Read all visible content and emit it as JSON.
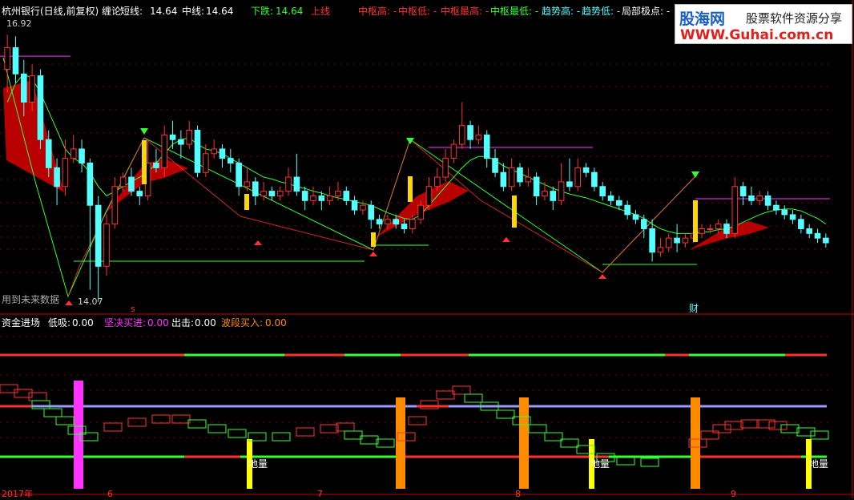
{
  "header": {
    "title": "杭州银行(日线,前复权) 缠论",
    "short_label": "短线:",
    "short_value": "14.64",
    "mid_label": "中线:",
    "mid_value": "14.64",
    "down_label": "下跌:",
    "down_value": "14.64",
    "up_label": "上线",
    "pivot_high": "中枢高: -",
    "pivot_low": "中枢低: -",
    "pivot_highest": "中枢最高: -",
    "pivot_lowest": "中枢最低: -",
    "trend_high": "趋势高: -",
    "trend_low": "趋势低: -",
    "local_extreme": "局部极点: -"
  },
  "main": {
    "high_label": "16.92",
    "low_label": "14.07",
    "future_note": "用到未来数据",
    "marker_s": "s",
    "marker_cai": "财"
  },
  "sub": {
    "title": "资金进场",
    "low_absorb_label": "低吸:",
    "low_absorb_value": "0.00",
    "firm_buy_label": "坚决买进:",
    "firm_buy_value": "0.00",
    "exit_label": "出击:",
    "exit_value": "0.00",
    "wave_buy_label": "波段买入:",
    "wave_buy_value": "0.00",
    "bottom_label": "地量"
  },
  "x_axis": {
    "labels": [
      "2017年",
      "6",
      "7",
      "8",
      "9"
    ]
  },
  "watermark": {
    "line1": "股海网",
    "line2": "股票软件资源分享",
    "line3": "WWW.Guhai.com.cn"
  },
  "colors": {
    "up": "#ff3232",
    "down": "#54ffff",
    "grid": "#8b0000",
    "green": "#33ff33",
    "purple": "#ff33ff",
    "orange": "#ff8c00",
    "yellow": "#ffff00"
  },
  "chart_data": {
    "type": "candlestick",
    "y_range": [
      14.0,
      17.1
    ],
    "price_marks": {
      "high": 16.92,
      "low": 14.07
    },
    "candles": [
      [
        16.55,
        16.78,
        16.92,
        16.3
      ],
      [
        16.78,
        16.5,
        16.9,
        16.4
      ],
      [
        16.5,
        16.2,
        16.65,
        16.05
      ],
      [
        16.2,
        16.48,
        16.6,
        16.1
      ],
      [
        16.48,
        15.8,
        16.55,
        15.7
      ],
      [
        15.8,
        15.5,
        15.9,
        15.4
      ],
      [
        15.5,
        15.3,
        15.6,
        15.1
      ],
      [
        15.3,
        15.6,
        15.8,
        15.2
      ],
      [
        15.6,
        15.7,
        15.85,
        15.55
      ],
      [
        15.7,
        15.55,
        15.8,
        15.45
      ],
      [
        15.55,
        15.1,
        15.6,
        14.2
      ],
      [
        15.1,
        14.45,
        15.2,
        14.07
      ],
      [
        14.45,
        14.9,
        15.0,
        14.35
      ],
      [
        14.9,
        15.3,
        15.4,
        14.85
      ],
      [
        15.3,
        15.4,
        15.45,
        15.25
      ],
      [
        15.4,
        15.25,
        15.5,
        15.2
      ],
      [
        15.25,
        15.2,
        15.3,
        15.1
      ],
      [
        15.2,
        15.55,
        15.8,
        15.15
      ],
      [
        15.55,
        15.5,
        15.7,
        15.45
      ],
      [
        15.5,
        15.85,
        15.95,
        15.4
      ],
      [
        15.85,
        15.8,
        16.0,
        15.7
      ],
      [
        15.8,
        15.75,
        15.9,
        15.6
      ],
      [
        15.75,
        15.9,
        16.0,
        15.7
      ],
      [
        15.9,
        15.45,
        15.95,
        15.4
      ],
      [
        15.45,
        15.65,
        15.75,
        15.4
      ],
      [
        15.65,
        15.7,
        15.8,
        15.6
      ],
      [
        15.7,
        15.6,
        15.75,
        15.5
      ],
      [
        15.6,
        15.55,
        15.7,
        15.45
      ],
      [
        15.55,
        15.3,
        15.6,
        15.2
      ],
      [
        15.3,
        15.35,
        15.5,
        15.25
      ],
      [
        15.35,
        15.2,
        15.4,
        15.1
      ],
      [
        15.2,
        15.25,
        15.35,
        15.15
      ],
      [
        15.25,
        15.2,
        15.3,
        15.15
      ],
      [
        15.2,
        15.25,
        15.3,
        15.15
      ],
      [
        15.25,
        15.4,
        15.5,
        15.2
      ],
      [
        15.4,
        15.25,
        15.65,
        15.2
      ],
      [
        15.25,
        15.15,
        15.3,
        15.05
      ],
      [
        15.15,
        15.2,
        15.3,
        15.1
      ],
      [
        15.2,
        15.15,
        15.25,
        15.05
      ],
      [
        15.15,
        15.2,
        15.3,
        15.1
      ],
      [
        15.2,
        15.25,
        15.35,
        15.15
      ],
      [
        15.25,
        15.15,
        15.3,
        15.1
      ],
      [
        15.15,
        15.05,
        15.2,
        15.0
      ],
      [
        15.05,
        15.1,
        15.15,
        15.0
      ],
      [
        15.1,
        14.95,
        15.15,
        14.85
      ],
      [
        14.95,
        14.9,
        15.0,
        14.85
      ],
      [
        14.9,
        14.95,
        15.0,
        14.85
      ],
      [
        14.95,
        14.9,
        15.0,
        14.85
      ],
      [
        14.9,
        14.85,
        14.95,
        14.8
      ],
      [
        14.85,
        14.95,
        15.0,
        14.8
      ],
      [
        14.95,
        15.1,
        15.15,
        14.9
      ],
      [
        15.1,
        15.3,
        15.4,
        15.05
      ],
      [
        15.3,
        15.4,
        15.5,
        15.25
      ],
      [
        15.4,
        15.6,
        15.7,
        15.35
      ],
      [
        15.6,
        15.75,
        15.8,
        15.55
      ],
      [
        15.75,
        15.95,
        16.2,
        15.7
      ],
      [
        15.95,
        15.8,
        16.0,
        15.7
      ],
      [
        15.8,
        15.85,
        15.95,
        15.75
      ],
      [
        15.85,
        15.6,
        15.9,
        15.5
      ],
      [
        15.6,
        15.45,
        15.7,
        15.4
      ],
      [
        15.45,
        15.3,
        15.55,
        15.25
      ],
      [
        15.3,
        15.5,
        15.6,
        15.25
      ],
      [
        15.5,
        15.35,
        15.55,
        15.3
      ],
      [
        15.35,
        15.4,
        15.5,
        15.3
      ],
      [
        15.4,
        15.2,
        15.45,
        15.1
      ],
      [
        15.2,
        15.25,
        15.35,
        15.15
      ],
      [
        15.25,
        15.15,
        15.3,
        15.05
      ],
      [
        15.15,
        15.35,
        15.55,
        15.1
      ],
      [
        15.35,
        15.3,
        15.6,
        15.25
      ],
      [
        15.3,
        15.5,
        15.6,
        15.25
      ],
      [
        15.5,
        15.45,
        15.55,
        15.4
      ],
      [
        15.45,
        15.3,
        15.5,
        15.25
      ],
      [
        15.3,
        15.2,
        15.35,
        15.15
      ],
      [
        15.2,
        15.15,
        15.25,
        15.1
      ],
      [
        15.15,
        15.1,
        15.2,
        15.05
      ],
      [
        15.1,
        15.0,
        15.15,
        14.95
      ],
      [
        15.0,
        14.95,
        15.05,
        14.9
      ],
      [
        14.95,
        14.85,
        15.0,
        14.75
      ],
      [
        14.85,
        14.6,
        14.95,
        14.5
      ],
      [
        14.6,
        14.65,
        14.75,
        14.55
      ],
      [
        14.65,
        14.75,
        14.8,
        14.6
      ],
      [
        14.75,
        14.7,
        14.9,
        14.6
      ],
      [
        14.7,
        14.75,
        14.8,
        14.65
      ],
      [
        14.75,
        14.8,
        14.85,
        14.7
      ],
      [
        14.8,
        14.85,
        14.9,
        14.75
      ],
      [
        14.85,
        14.85,
        14.9,
        14.8
      ],
      [
        14.85,
        14.9,
        14.95,
        14.8
      ],
      [
        14.9,
        14.8,
        14.95,
        14.75
      ],
      [
        14.8,
        15.3,
        15.4,
        14.75
      ],
      [
        15.3,
        15.2,
        15.35,
        15.1
      ],
      [
        15.2,
        15.15,
        15.3,
        15.1
      ],
      [
        15.15,
        15.2,
        15.25,
        15.1
      ],
      [
        15.2,
        15.1,
        15.25,
        15.05
      ],
      [
        15.1,
        15.05,
        15.15,
        15.0
      ],
      [
        15.05,
        15.0,
        15.1,
        14.95
      ],
      [
        15.0,
        14.95,
        15.05,
        14.9
      ],
      [
        14.95,
        14.85,
        15.0,
        14.8
      ],
      [
        14.85,
        14.8,
        14.9,
        14.75
      ],
      [
        14.8,
        14.75,
        14.85,
        14.7
      ],
      [
        14.75,
        14.7,
        14.8,
        14.65
      ]
    ],
    "lines": {
      "short": [
        16.2,
        16.4,
        16.5,
        16.45,
        16.3,
        16.1,
        15.9,
        15.7,
        15.6,
        15.55,
        15.45,
        15.3,
        15.2,
        15.25,
        15.3,
        15.35,
        15.4,
        15.45,
        15.55,
        15.65,
        15.75,
        15.8,
        15.82,
        15.75,
        15.7,
        15.68,
        15.65,
        15.6,
        15.55,
        15.5,
        15.45,
        15.4,
        15.38,
        15.35,
        15.33,
        15.3,
        15.28,
        15.25,
        15.23,
        15.2,
        15.18,
        15.16,
        15.14,
        15.12,
        15.1,
        15.06,
        15.02,
        14.99,
        14.96,
        14.95,
        15.0,
        15.1,
        15.2,
        15.3,
        15.4,
        15.5,
        15.58,
        15.62,
        15.62,
        15.58,
        15.52,
        15.48,
        15.44,
        15.4,
        15.36,
        15.32,
        15.28,
        15.25,
        15.22,
        15.2,
        15.18,
        15.15,
        15.12,
        15.09,
        15.06,
        15.03,
        15.0,
        14.96,
        14.9,
        14.85,
        14.82,
        14.8,
        14.8,
        14.8,
        14.81,
        14.82,
        14.84,
        14.85,
        14.88,
        14.92,
        14.96,
        15.0,
        15.03,
        15.05,
        15.06,
        15.06,
        15.04,
        15.0,
        14.96,
        14.9
      ]
    }
  }
}
